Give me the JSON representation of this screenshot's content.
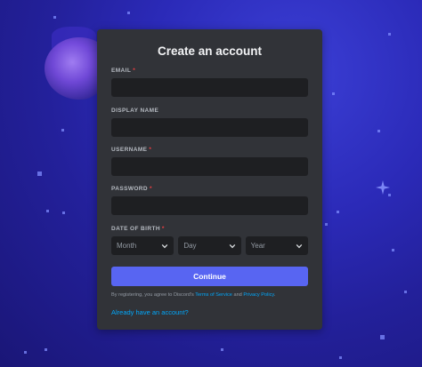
{
  "form": {
    "title": "Create an account",
    "email": {
      "label": "EMAIL",
      "required_mark": "*",
      "value": ""
    },
    "display_name": {
      "label": "DISPLAY NAME",
      "value": ""
    },
    "username": {
      "label": "USERNAME",
      "required_mark": "*",
      "value": ""
    },
    "password": {
      "label": "PASSWORD",
      "required_mark": "*",
      "value": ""
    },
    "dob": {
      "label": "DATE OF BIRTH",
      "required_mark": "*",
      "month_placeholder": "Month",
      "day_placeholder": "Day",
      "year_placeholder": "Year"
    },
    "continue_label": "Continue",
    "terms_prefix": "By registering, you agree to Discord's ",
    "terms_link": "Terms of Service",
    "terms_mid": " and ",
    "privacy_link": "Privacy Policy",
    "terms_suffix": ".",
    "login_link": "Already have an account?"
  },
  "colors": {
    "card": "#313338",
    "input": "#1e1f22",
    "accent": "#5865f2",
    "link": "#00a8fc",
    "required": "#f23f43"
  }
}
